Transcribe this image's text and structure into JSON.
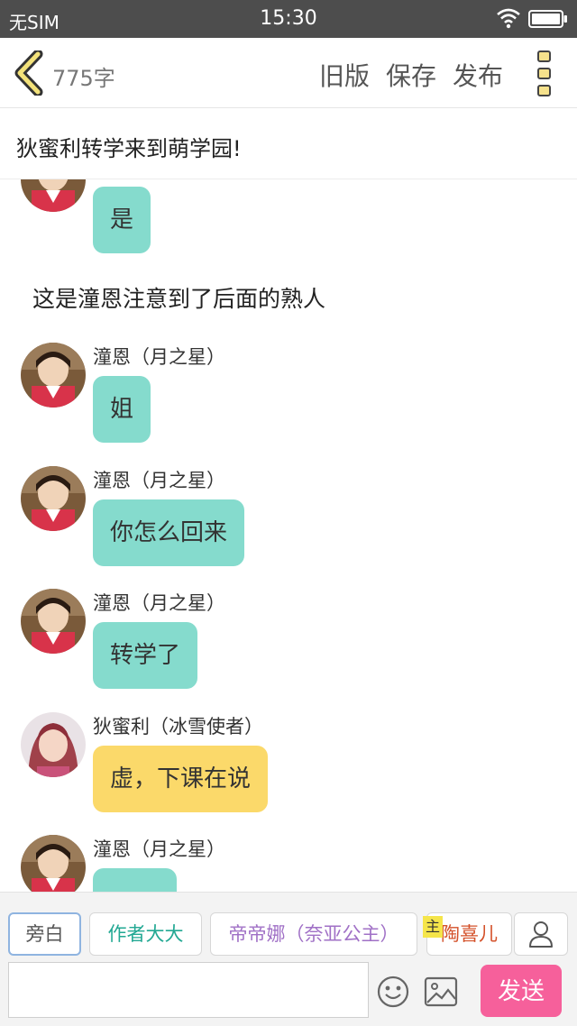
{
  "status_bar": {
    "carrier": "无SIM",
    "time": "15:30",
    "wifi_icon": "wifi-icon",
    "battery_icon": "battery-icon"
  },
  "toolbar": {
    "back_icon": "chevron-left-icon",
    "word_count": "775字",
    "old_version": "旧版",
    "save": "保存",
    "publish": "发布",
    "more_icon": "more-vertical-icon"
  },
  "story": {
    "title": "狄蜜利转学来到萌学园!"
  },
  "chat": {
    "messages": [
      {
        "type": "dialogue",
        "character": "tongen",
        "sender": "",
        "text": "是",
        "color": "teal"
      },
      {
        "type": "narration",
        "text": "这是潼恩注意到了后面的熟人"
      },
      {
        "type": "dialogue",
        "character": "tongen",
        "sender": "潼恩（月之星）",
        "text": "姐",
        "color": "teal"
      },
      {
        "type": "dialogue",
        "character": "tongen",
        "sender": "潼恩（月之星）",
        "text": "你怎么回来",
        "color": "teal"
      },
      {
        "type": "dialogue",
        "character": "tongen",
        "sender": "潼恩（月之星）",
        "text": "转学了",
        "color": "teal"
      },
      {
        "type": "dialogue",
        "character": "dimili",
        "sender": "狄蜜利（冰雪使者）",
        "text": "虚，下课在说",
        "color": "yellow"
      },
      {
        "type": "dialogue",
        "character": "tongen",
        "sender": "潼恩（月之星）",
        "text": "",
        "color": "teal"
      }
    ]
  },
  "characters": {
    "narration": "旁白",
    "author": "作者大大",
    "princess": "帝帝娜（奈亚公主）",
    "main_tag": "主",
    "tao": "陶喜儿",
    "add_icon": "user-icon"
  },
  "input": {
    "value": "",
    "placeholder": "",
    "emoji_icon": "smiley-icon",
    "image_icon": "image-icon",
    "send": "发送"
  },
  "colors": {
    "teal_bubble": "#85dbcd",
    "yellow_bubble": "#fbd96a",
    "send_button": "#f6609b",
    "author_chip": "#22a893",
    "princess_chip": "#a070c6",
    "tao_chip": "#d4512a",
    "status_bar": "#4d4d4d"
  }
}
